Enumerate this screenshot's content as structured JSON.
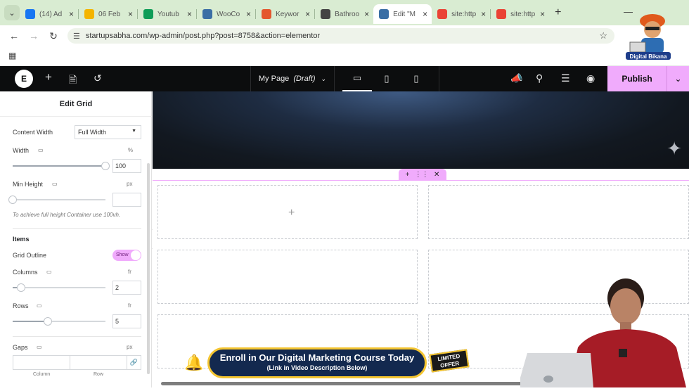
{
  "browser": {
    "tabs": [
      {
        "title": "(14) Ad",
        "fav": "meta-icon",
        "color": "#1877f2"
      },
      {
        "title": "06 Feb",
        "fav": "drive-icon",
        "color": "#f4b400"
      },
      {
        "title": "Youtub",
        "fav": "sheets-icon",
        "color": "#0f9d58"
      },
      {
        "title": "WooCo",
        "fav": "wordpress-icon",
        "color": "#3a6ea5"
      },
      {
        "title": "Keywor",
        "fav": "keyword-icon",
        "color": "#e4572e"
      },
      {
        "title": "Bathroo",
        "fav": "openai-icon",
        "color": "#444444"
      },
      {
        "title": "Edit \"M",
        "fav": "wordpress-icon",
        "color": "#3a6ea5"
      },
      {
        "title": "site:http",
        "fav": "google-icon",
        "color": "#ea4335"
      },
      {
        "title": "site:http",
        "fav": "google-icon",
        "color": "#ea4335"
      }
    ],
    "active_tab": 6,
    "url": "startupsabha.com/wp-admin/post.php?post=8758&action=elementor"
  },
  "elementor": {
    "page_name": "My Page",
    "page_status": "(Draft)",
    "publish_label": "Publish",
    "accent": "#f0abfc"
  },
  "panel": {
    "title": "Edit Grid",
    "content_width": {
      "label": "Content Width",
      "value": "Full Width"
    },
    "width": {
      "label": "Width",
      "unit": "%",
      "value": "100",
      "level": 1.0
    },
    "min_height": {
      "label": "Min Height",
      "unit": "px",
      "value": "",
      "level": 0.0
    },
    "hint": "To achieve full height Container use 100vh.",
    "items_heading": "Items",
    "grid_outline": {
      "label": "Grid Outline",
      "state": "Show"
    },
    "columns": {
      "label": "Columns",
      "unit": "fr",
      "value": "2",
      "level": 0.09
    },
    "rows": {
      "label": "Rows",
      "unit": "fr",
      "value": "5",
      "level": 0.38
    },
    "gaps": {
      "label": "Gaps",
      "unit": "px",
      "col_label": "Column",
      "row_label": "Row"
    }
  },
  "promo": {
    "line1": "Enroll in Our Digital Marketing Course Today",
    "line2": "(Link in Video Description Below)",
    "offer_line1": "LIMITED",
    "offer_line2": "OFFER"
  },
  "branding": {
    "channel": "Digital Bikana"
  }
}
